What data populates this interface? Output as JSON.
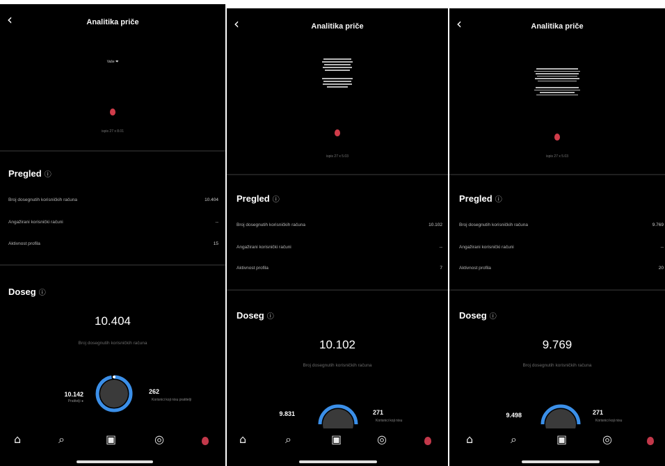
{
  "header": {
    "title": "Analitika priče",
    "back_icon": "chevron-left-icon"
  },
  "panels": [
    {
      "story_caption_top": "Vaše ❤",
      "story_caption_bottom": "ispis 27 x 8.01",
      "overview": {
        "heading": "Pregled",
        "rows": [
          {
            "label": "Broj dosegnutih korisničkih računa",
            "value": "10.404"
          },
          {
            "label": "Angažirani korisnički računi",
            "value": "--"
          },
          {
            "label": "Aktivnost profila",
            "value": "15"
          }
        ]
      },
      "reach": {
        "heading": "Doseg",
        "total": "10.404",
        "subtitle": "Broj dosegnutih korisničkih računa",
        "left_value": "10.142",
        "left_label": "Pratitelji ●",
        "right_value": "262",
        "right_label": "Korisnici koji nisu pratitelji",
        "followers_fraction": 0.975
      }
    },
    {
      "story_caption_bottom": "ispis 27 x 5.03",
      "overview": {
        "heading": "Pregled",
        "rows": [
          {
            "label": "Broj dosegnutih korisničkih računa",
            "value": "10.102"
          },
          {
            "label": "Angažirani korisnički računi",
            "value": "--"
          },
          {
            "label": "Aktivnost profila",
            "value": "7"
          }
        ]
      },
      "reach": {
        "heading": "Doseg",
        "total": "10.102",
        "subtitle": "Broj dosegnutih korisničkih računa",
        "left_value": "9.831",
        "right_value": "271",
        "right_label": "Korisnici koji nisu"
      }
    },
    {
      "story_caption_bottom": "ispis 27 x 5.03",
      "overview": {
        "heading": "Pregled",
        "rows": [
          {
            "label": "Broj dosegnutih korisničkih računa",
            "value": "9.769"
          },
          {
            "label": "Angažirani korisnički računi",
            "value": "--"
          },
          {
            "label": "Aktivnost profila",
            "value": "20"
          }
        ]
      },
      "reach": {
        "heading": "Doseg",
        "total": "9.769",
        "subtitle": "Broj dosegnutih korisničkih računa",
        "left_value": "9.498",
        "right_value": "271",
        "right_label": "Korisnici koji nisu"
      }
    }
  ],
  "nav": {
    "home_icon": "⌂",
    "search_icon": "⌕",
    "reels_icon": "▣",
    "shop_icon": "◎"
  },
  "colors": {
    "background": "#000000",
    "ring_followers": "#3b8fe8",
    "ring_track": "#2a2a2a",
    "pin": "#c2384a"
  }
}
